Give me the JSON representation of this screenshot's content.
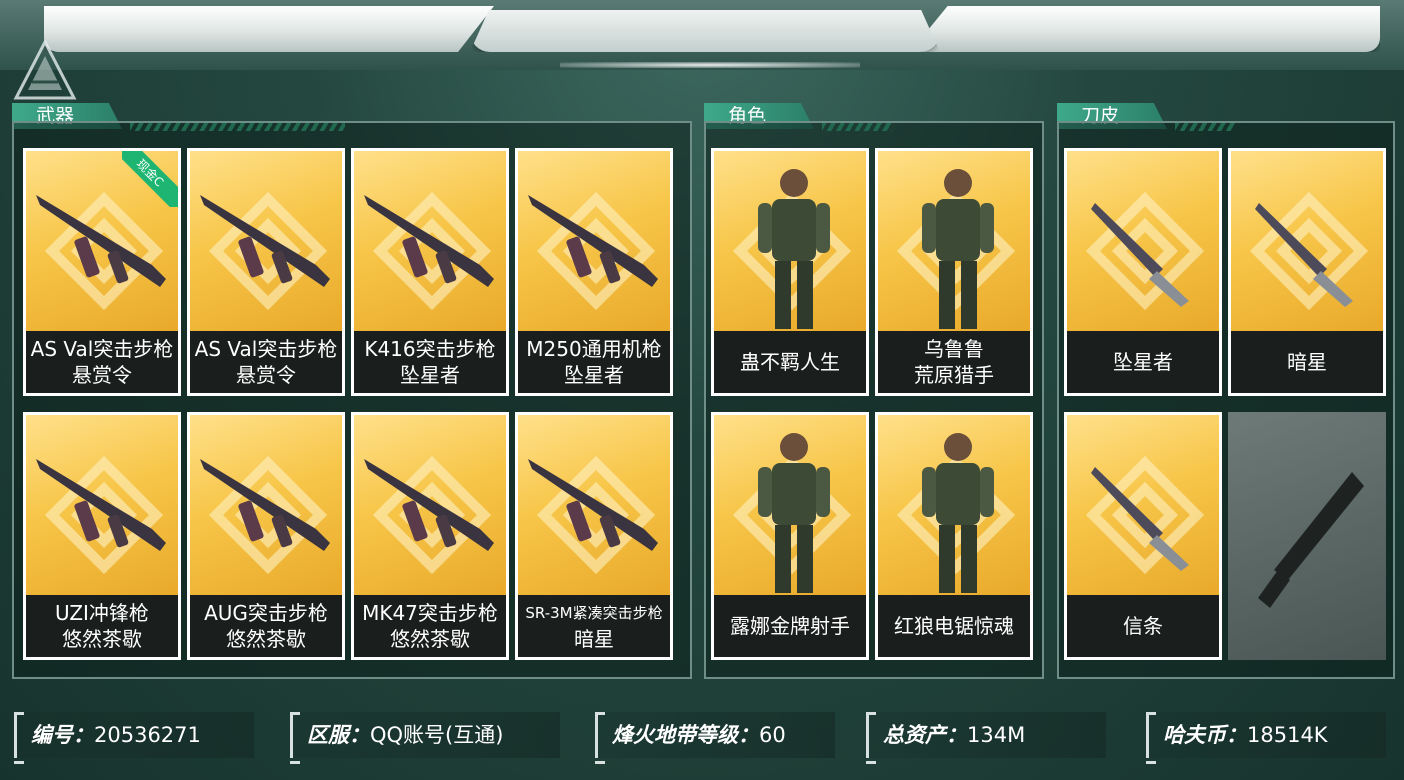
{
  "sections": {
    "weapons": {
      "title": "武器"
    },
    "characters": {
      "title": "角色"
    },
    "knives": {
      "title": "刀皮"
    }
  },
  "weapons": [
    {
      "line1": "AS Val突击步枪",
      "line2": "悬赏令",
      "badge": "现金C",
      "art": "assault-rifle-icon"
    },
    {
      "line1": "AS Val突击步枪",
      "line2": "悬赏令",
      "art": "assault-rifle-icon"
    },
    {
      "line1": "K416突击步枪",
      "line2": "坠星者",
      "art": "assault-rifle-icon"
    },
    {
      "line1": "M250通用机枪",
      "line2": "坠星者",
      "art": "machine-gun-icon"
    },
    {
      "line1": "UZI冲锋枪",
      "line2": "悠然茶歇",
      "art": "smg-icon"
    },
    {
      "line1": "AUG突击步枪",
      "line2": "悠然茶歇",
      "art": "assault-rifle-icon"
    },
    {
      "line1": "MK47突击步枪",
      "line2": "悠然茶歇",
      "art": "assault-rifle-icon"
    },
    {
      "line1": "SR-3M紧凑突击步枪",
      "line2": "暗星",
      "art": "compact-rifle-icon"
    }
  ],
  "characters": [
    {
      "line1": "蛊不羁人生",
      "line2": "",
      "art": "operator-figure-icon"
    },
    {
      "line1": "乌鲁鲁",
      "line2": "荒原猎手",
      "art": "operator-figure-icon"
    },
    {
      "line1": "露娜金牌射手",
      "line2": "",
      "art": "operator-figure-icon"
    },
    {
      "line1": "红狼电锯惊魂",
      "line2": "",
      "art": "operator-figure-icon"
    }
  ],
  "knives": [
    {
      "line1": "坠星者",
      "art": "knife-icon"
    },
    {
      "line1": "暗星",
      "art": "knife-icon"
    },
    {
      "line1": "信条",
      "art": "knife-icon"
    },
    {
      "line1": "",
      "art": "knife-silhouette-icon",
      "empty": true
    }
  ],
  "info": {
    "id": {
      "label": "编号：",
      "value": "20536271"
    },
    "server": {
      "label": "区服：",
      "value": "QQ账号(互通)"
    },
    "level": {
      "label": "烽火地带等级：",
      "value": "60"
    },
    "assets": {
      "label": "总资产：",
      "value": "134M"
    },
    "coins": {
      "label": "哈夫币：",
      "value": "18514K"
    }
  },
  "colors": {
    "accent": "#3fa98a",
    "card_gold": "#f7c649",
    "label_bg": "#1a1f1d",
    "badge": "#1db571"
  }
}
